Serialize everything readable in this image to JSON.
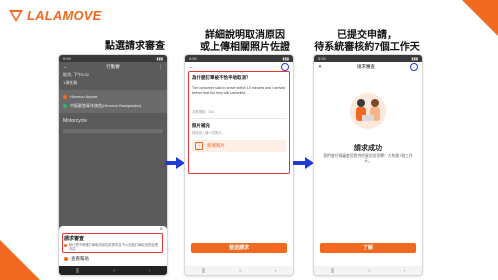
{
  "brand": {
    "name": "LALAMOVE",
    "color": "#f26a21"
  },
  "steps": [
    {
      "caption": [
        "點選請求審查"
      ]
    },
    {
      "caption": [
        "詳細說明取消原因",
        "或上傳相關照片佐證"
      ]
    },
    {
      "caption": [
        "已提交申請，",
        "待系統審核約7個工作天"
      ]
    }
  ],
  "phone1": {
    "status_time": "5:59",
    "title": "行動審",
    "order_line": "取消, 下午5:32",
    "sub_line": "1項任務",
    "stops": [
      "Hinxeon Airport",
      "中區歐陸青年旅舍(Hinxeon Backpacker)"
    ],
    "section_label": "Motorcycle",
    "sheet": {
      "close_icon": "×",
      "title": "請求審查",
      "desc": "就什麼不明確訂單取消原因或異常並予以自動訂單取消的處理內容",
      "help_label": "查看幫助"
    }
  },
  "phone2": {
    "status_time": "5:59",
    "question": "為什麼訂單被不恰平地取消？",
    "reason_text": "The customer said to arrive within 15 minutes and I arrived before that but they still cancelled.",
    "char_count": "字數限制：304",
    "photo_title": "照片補充",
    "photo_hint": "拍攝或上傳人員照片。",
    "upload_label": "新增照片",
    "submit_label": "發送請求"
  },
  "phone3": {
    "status_time": "5:59",
    "title": "請求審查",
    "success_title": "請求成功",
    "success_desc": "我們會仔細審查您提供的資訊並答覆！大約需7個工作天。",
    "done_label": "了解"
  }
}
